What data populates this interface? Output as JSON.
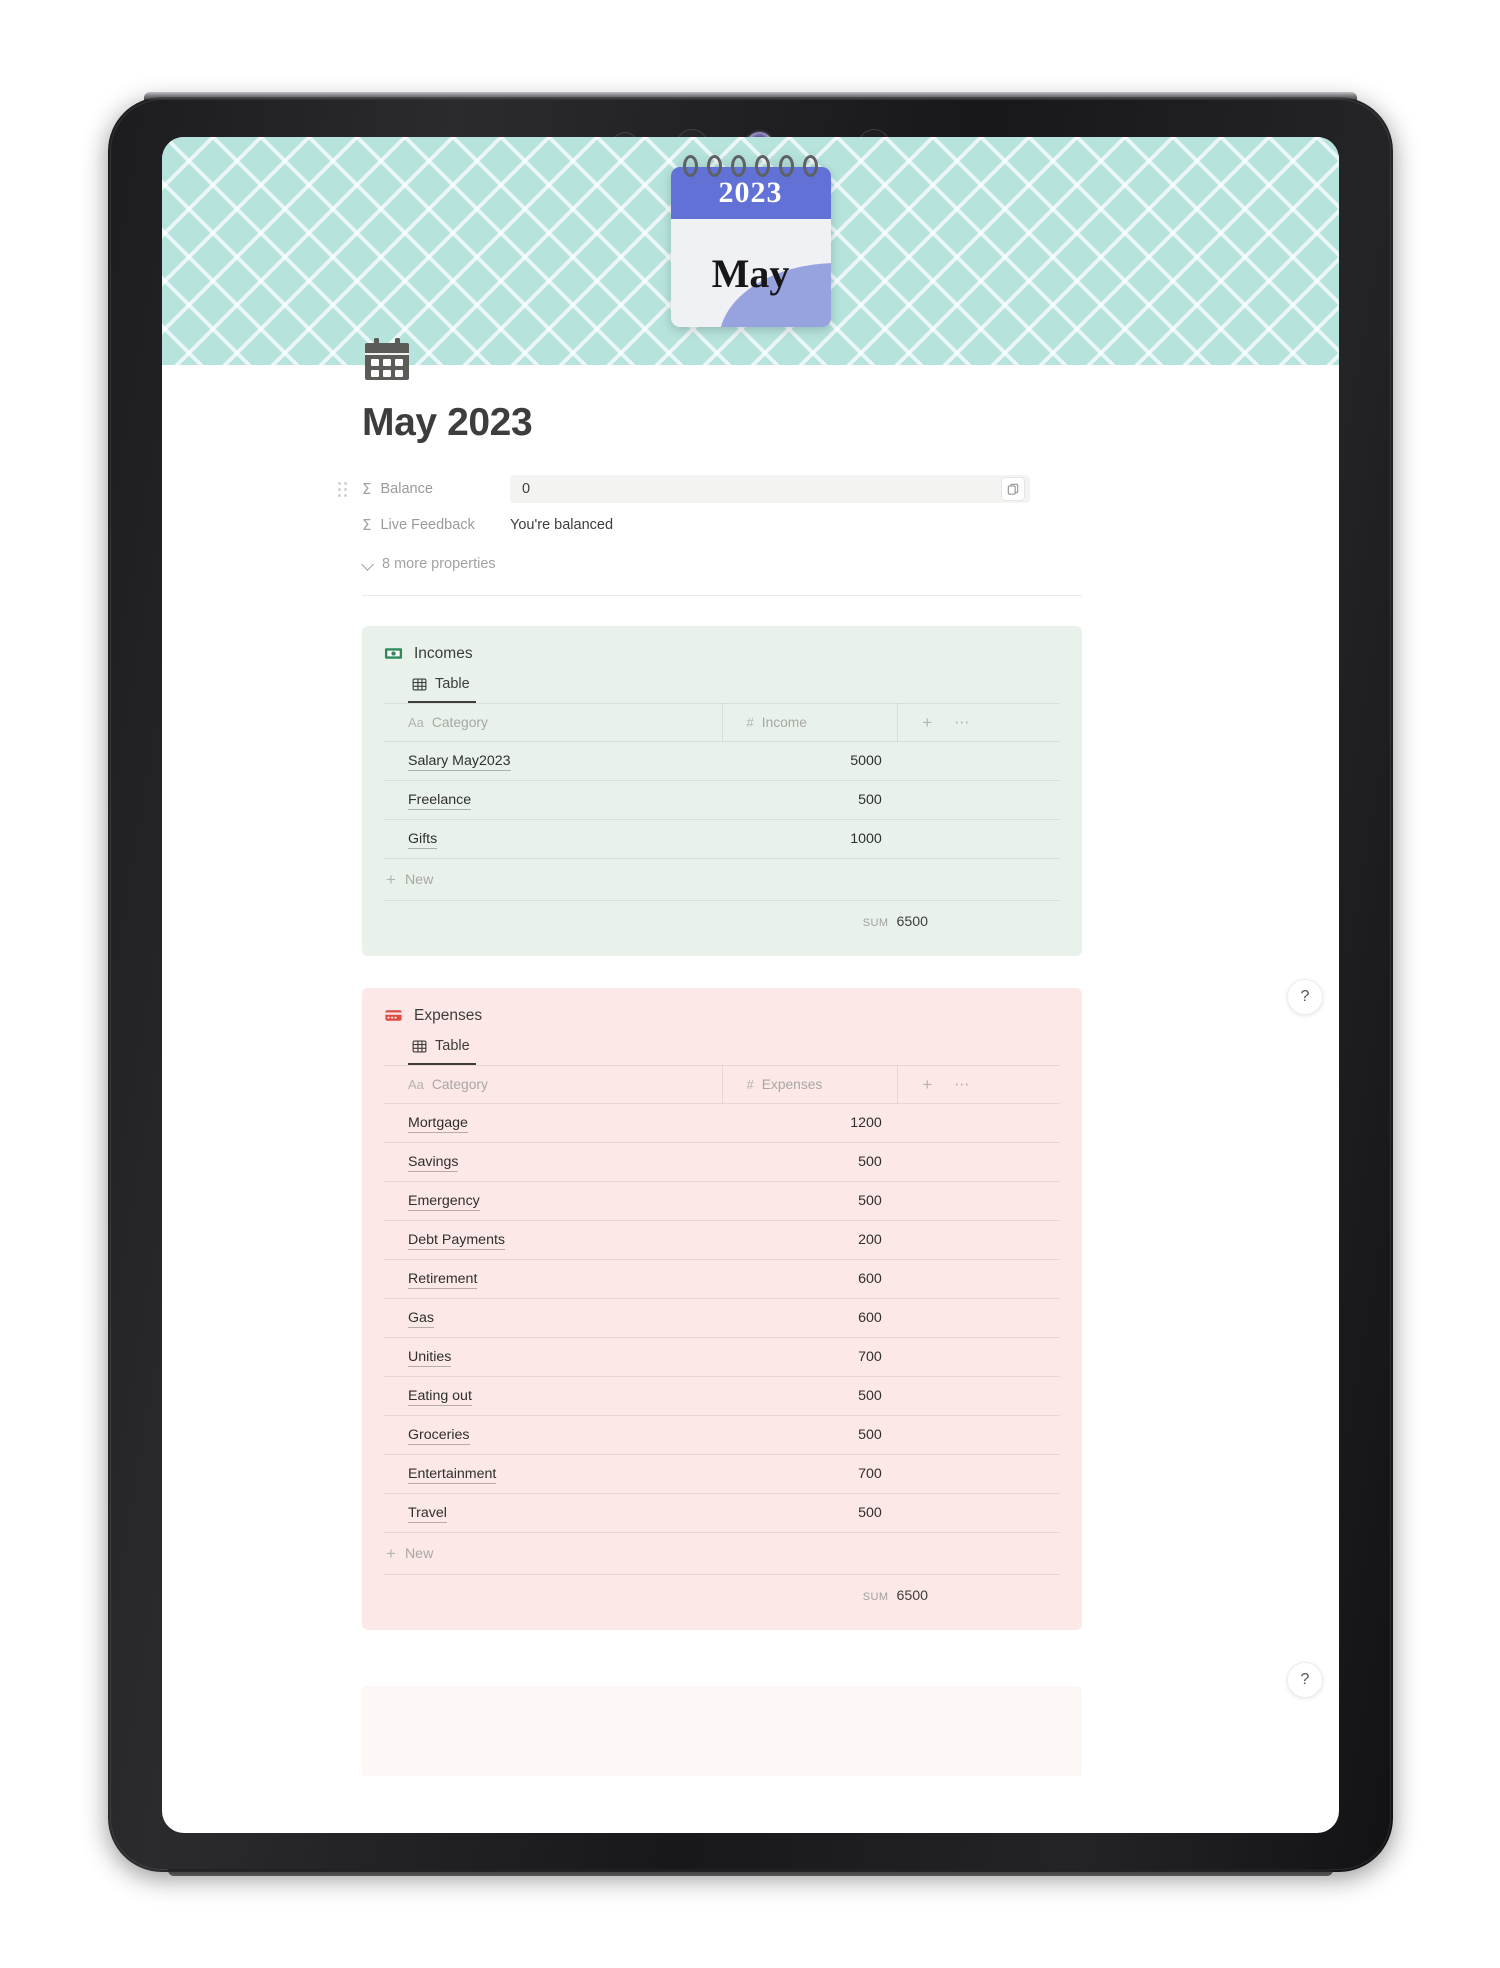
{
  "device": {
    "type": "tablet",
    "sensors": [
      "sensor-ring",
      "sensor-ring-wide",
      "camera-lens",
      "sensor-dot",
      "sensor-ring-wide"
    ]
  },
  "cover": {
    "pattern": "chevron",
    "background_color": "#b7e3dd",
    "calendar_graphic": {
      "year": "2023",
      "month": "May",
      "header_color": "#6271d6",
      "page_color": "#f0f1f4",
      "accent_color": "#97a3de",
      "ring_count": 6
    }
  },
  "page": {
    "icon": "calendar-icon",
    "title": "May 2023"
  },
  "properties": {
    "rows": [
      {
        "label": "Balance",
        "type_icon": "formula-sigma-icon",
        "value": "0",
        "has_field": true,
        "action_icon": "copy-icon"
      },
      {
        "label": "Live Feedback",
        "type_icon": "formula-sigma-icon",
        "value": "You're balanced",
        "has_field": false
      }
    ],
    "more_properties_label": "8 more properties",
    "chevron_icon": "chevron-down-icon",
    "drag_handle_icon": "drag-handle-icon"
  },
  "databases": [
    {
      "id": "incomes",
      "title": "Incomes",
      "icon": "banknote-icon",
      "icon_color": "#2e8a5a",
      "block_color": "#e9f2ea",
      "tab": {
        "label": "Table",
        "icon": "table-grid-icon",
        "active": true
      },
      "columns": [
        {
          "label": "Category",
          "type_glyph": "Aa"
        },
        {
          "label": "Income",
          "type_glyph": "#"
        }
      ],
      "add_column_icon": "plus-icon",
      "more_options_icon": "ellipsis-icon",
      "rows": [
        {
          "category": "Salary May2023",
          "value": "5000"
        },
        {
          "category": "Freelance",
          "value": "500"
        },
        {
          "category": "Gifts",
          "value": "1000"
        }
      ],
      "new_row_label": "New",
      "new_row_icon": "plus-icon",
      "sum_label": "SUM",
      "sum_value": "6500"
    },
    {
      "id": "expenses",
      "title": "Expenses",
      "icon": "credit-card-icon",
      "icon_color": "#e04a40",
      "block_color": "#fbe8e7",
      "tab": {
        "label": "Table",
        "icon": "table-grid-icon",
        "active": true
      },
      "columns": [
        {
          "label": "Category",
          "type_glyph": "Aa"
        },
        {
          "label": "Expenses",
          "type_glyph": "#"
        }
      ],
      "add_column_icon": "plus-icon",
      "more_options_icon": "ellipsis-icon",
      "rows": [
        {
          "category": "Mortgage",
          "value": "1200"
        },
        {
          "category": "Savings",
          "value": "500"
        },
        {
          "category": "Emergency",
          "value": "500"
        },
        {
          "category": "Debt Payments",
          "value": "200"
        },
        {
          "category": "Retirement",
          "value": "600"
        },
        {
          "category": "Gas",
          "value": "600"
        },
        {
          "category": "Unities",
          "value": "700"
        },
        {
          "category": "Eating out",
          "value": "500"
        },
        {
          "category": "Groceries",
          "value": "500"
        },
        {
          "category": "Entertainment",
          "value": "700"
        },
        {
          "category": "Travel",
          "value": "500"
        }
      ],
      "new_row_label": "New",
      "new_row_icon": "plus-icon",
      "sum_label": "SUM",
      "sum_value": "6500"
    }
  ],
  "help_buttons": [
    {
      "label": "?",
      "name": "help-button-top"
    },
    {
      "label": "?",
      "name": "help-button-bottom"
    }
  ]
}
